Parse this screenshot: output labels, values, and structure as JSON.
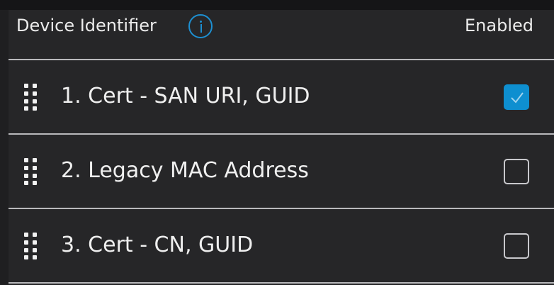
{
  "header": {
    "title": "Device Identifier",
    "enabled_label": "Enabled",
    "info_icon": "info-circle-icon"
  },
  "colors": {
    "accent": "#0e8fd0",
    "background": "#262628",
    "divider": "#b9b9bc"
  },
  "rows": [
    {
      "label": "1. Cert - SAN URI, GUID",
      "enabled": true
    },
    {
      "label": "2. Legacy MAC Address",
      "enabled": false
    },
    {
      "label": "3. Cert - CN, GUID",
      "enabled": false
    }
  ]
}
